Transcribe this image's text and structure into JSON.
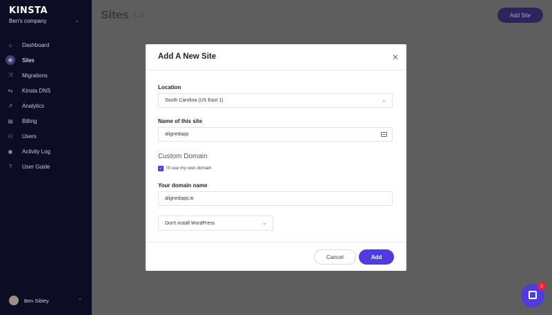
{
  "sidebar": {
    "logo": "KINSTA",
    "company": "Ben's company",
    "items": [
      {
        "label": "Dashboard",
        "icon": "home-icon",
        "glyph": "⌂"
      },
      {
        "label": "Sites",
        "icon": "gear-icon",
        "glyph": "✲"
      },
      {
        "label": "Migrations",
        "icon": "migrate-icon",
        "glyph": "⤨"
      },
      {
        "label": "Kinsta DNS",
        "icon": "dns-icon",
        "glyph": "⇆"
      },
      {
        "label": "Analytics",
        "icon": "analytics-icon",
        "glyph": "↗"
      },
      {
        "label": "Billing",
        "icon": "billing-icon",
        "glyph": "▤"
      },
      {
        "label": "Users",
        "icon": "users-icon",
        "glyph": "⚇"
      },
      {
        "label": "Activity Log",
        "icon": "eye-icon",
        "glyph": "◉"
      },
      {
        "label": "User Guide",
        "icon": "help-icon",
        "glyph": "?"
      }
    ],
    "active": "Sites",
    "user_name": "Ben Sibley"
  },
  "header": {
    "title": "Sites",
    "count": "0 / 3",
    "add_button": "Add Site"
  },
  "modal": {
    "title": "Add A New Site",
    "location_label": "Location",
    "location_value": "South Carolina (US East 1)",
    "site_name_label": "Name of this site",
    "site_name_value": "alignedapp",
    "custom_domain_heading": "Custom Domain",
    "own_domain_checkbox": "I'll use my own domain",
    "own_domain_checked": true,
    "domain_label": "Your domain name",
    "domain_value": "alignedapp.io",
    "wordpress_select": "Don't install WordPress",
    "cancel": "Cancel",
    "add": "Add"
  },
  "chat": {
    "badge": "1"
  },
  "colors": {
    "accent": "#4f3be0",
    "sidebar_bg": "#0c0d24",
    "badge": "#e8233a"
  }
}
